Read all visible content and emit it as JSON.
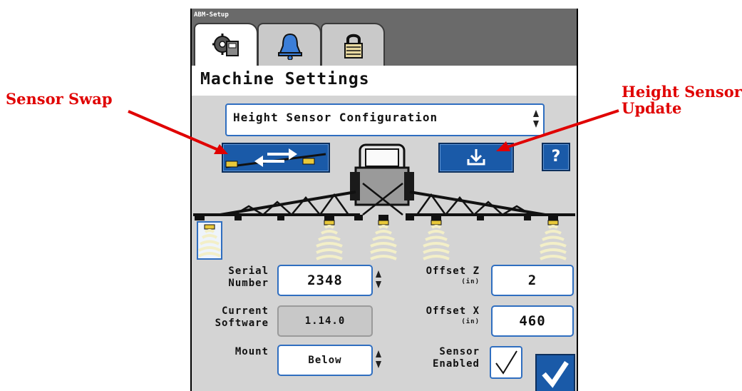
{
  "callouts": {
    "left": "Sensor Swap",
    "right_line1": "Height Sensor",
    "right_line2": "Update"
  },
  "app": {
    "title": "ABM-Setup"
  },
  "tabs": [
    {
      "icon": "machine-settings-icon",
      "active": true
    },
    {
      "icon": "bell-icon",
      "active": false
    },
    {
      "icon": "padlock-icon",
      "active": false
    }
  ],
  "page": {
    "title": "Machine Settings"
  },
  "config_select": {
    "value": "Height Sensor Configuration"
  },
  "toolbar": {
    "help_label": "?",
    "sensor_swap_icon": "sensor-swap-icon",
    "update_icon": "download-icon"
  },
  "form": {
    "serial_label_1": "Serial",
    "serial_label_2": "Number",
    "serial_value": "2348",
    "software_label_1": "Current",
    "software_label_2": "Software",
    "software_value": "1.14.0",
    "mount_label": "Mount",
    "mount_value": "Below",
    "offset_z_label": "Offset Z",
    "offset_z_unit": "(in)",
    "offset_z_value": "2",
    "offset_x_label": "Offset X",
    "offset_x_unit": "(in)",
    "offset_x_value": "460",
    "sensor_enabled_label_1": "Sensor",
    "sensor_enabled_label_2": "Enabled",
    "sensor_enabled": true
  },
  "colors": {
    "callout": "#e00000",
    "button_blue": "#1a5aa8",
    "field_border": "#2f6ec0",
    "screen_bg": "#d4d4d4"
  }
}
